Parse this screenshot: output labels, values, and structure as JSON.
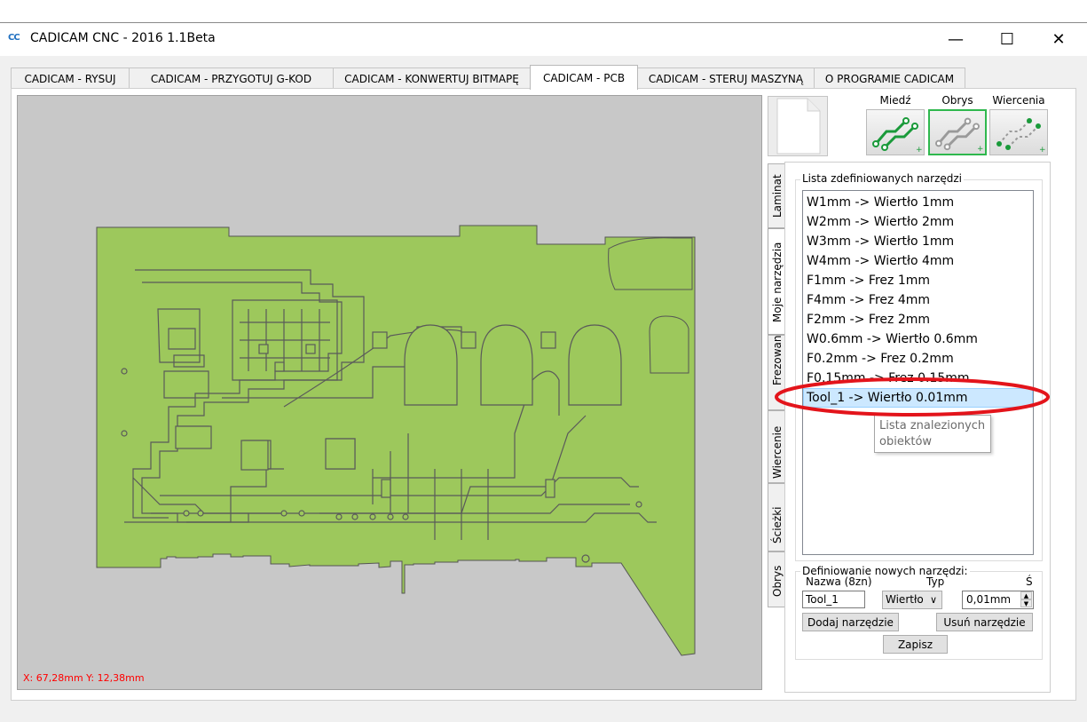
{
  "window": {
    "logo": "CC",
    "title": "CADICAM CNC - 2016 1.1Beta",
    "minimize": "—",
    "maximize": "☐",
    "close": "✕"
  },
  "tabs": [
    {
      "label": "CADICAM - RYSUJ",
      "active": false
    },
    {
      "label": "CADICAM - PRZYGOTUJ G-KOD",
      "active": false
    },
    {
      "label": "CADICAM - KONWERTUJ BITMAPĘ",
      "active": false
    },
    {
      "label": "CADICAM - PCB",
      "active": true
    },
    {
      "label": "CADICAM - STERUJ MASZYNĄ",
      "active": false
    },
    {
      "label": "O PROGRAMIE CADICAM",
      "active": false
    }
  ],
  "canvas": {
    "coordinates": "X: 67,28mm Y: 12,38mm",
    "board_color": "#9dc85c",
    "background_color": "#c8c8c8"
  },
  "layers": {
    "copper": "Miedź",
    "outline": "Obrys",
    "drills": "Wiercenia"
  },
  "side_tabs": [
    "Laminat",
    "Moje narzędzia",
    "Frezowanie",
    "Wiercenie",
    "Ścieżki",
    "Obrys"
  ],
  "tool_list": {
    "group_title": "Lista zdefiniowanych narzędzi",
    "items": [
      "W1mm -> Wiertło 1mm",
      "W2mm -> Wiertło 2mm",
      "W3mm -> Wiertło 1mm",
      "W4mm -> Wiertło 4mm",
      "F1mm -> Frez 1mm",
      "F4mm -> Frez 4mm",
      "F2mm -> Frez 2mm",
      "W0.6mm -> Wiertło 0.6mm",
      "F0.2mm -> Frez 0.2mm",
      "F0.15mm -> Frez 0.15mm",
      "Tool_1 -> Wiertło 0.01mm"
    ],
    "selected_index": 10,
    "tooltip": "Lista znalezionych obiektów"
  },
  "define_tool": {
    "group_title": "Definiowanie nowych narzędzi:",
    "name_label": "Nazwa (8zn)",
    "type_label": "Typ",
    "size_label": "Ś",
    "name_value": "Tool_1",
    "type_value": "Wiertło",
    "size_value": "0,01mm",
    "add_button": "Dodaj narzędzie",
    "remove_button": "Usuń narzędzie",
    "save_button": "Zapisz"
  },
  "annotation_color": "#e3141b"
}
